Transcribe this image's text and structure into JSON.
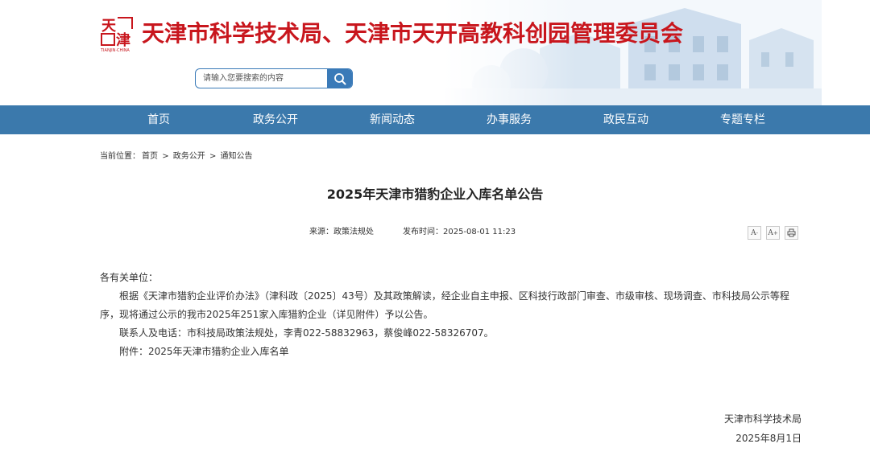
{
  "header": {
    "logo_text": "天津",
    "logo_caption": "TIANJIN·CHINA",
    "site_title": "天津市科学技术局、天津市天开高教科创园管理委员会",
    "search_placeholder": "请输入您要搜索的内容",
    "search_icon": "search-icon"
  },
  "nav": {
    "items": [
      {
        "label": "首页"
      },
      {
        "label": "政务公开"
      },
      {
        "label": "新闻动态"
      },
      {
        "label": "办事服务"
      },
      {
        "label": "政民互动"
      },
      {
        "label": "专题专栏"
      }
    ]
  },
  "breadcrumb": {
    "prefix": "当前位置：",
    "items": [
      "首页",
      "政务公开",
      "通知公告"
    ],
    "separator": ">"
  },
  "article": {
    "title": "2025年天津市猎豹企业入库名单公告",
    "source_label": "来源：政策法规处",
    "date_label": "发布时间：2025-08-01 11:23",
    "tools": {
      "font_smaller": "A",
      "font_larger": "A",
      "print_icon": "print-icon"
    },
    "greeting": "各有关单位：",
    "paragraph1": "根据《天津市猎豹企业评价办法》（津科政〔2025〕43号）及其政策解读，经企业自主申报、区科技行政部门审查、市级审核、现场调查、市科技局公示等程序，现将通过公示的我市2025年251家入库猎豹企业（详见附件）予以公告。",
    "contact": "联系人及电话：市科技局政策法规处，李青022-58832963，蔡俊峰022-58326707。",
    "attachment": "附件：2025年天津市猎豹企业入库名单",
    "signature_org": "天津市科学技术局",
    "signature_date": "2025年8月1日"
  },
  "colors": {
    "nav_bg": "#3b79ac",
    "title_red": "#c8161d",
    "search_blue": "#3a7ab8"
  }
}
